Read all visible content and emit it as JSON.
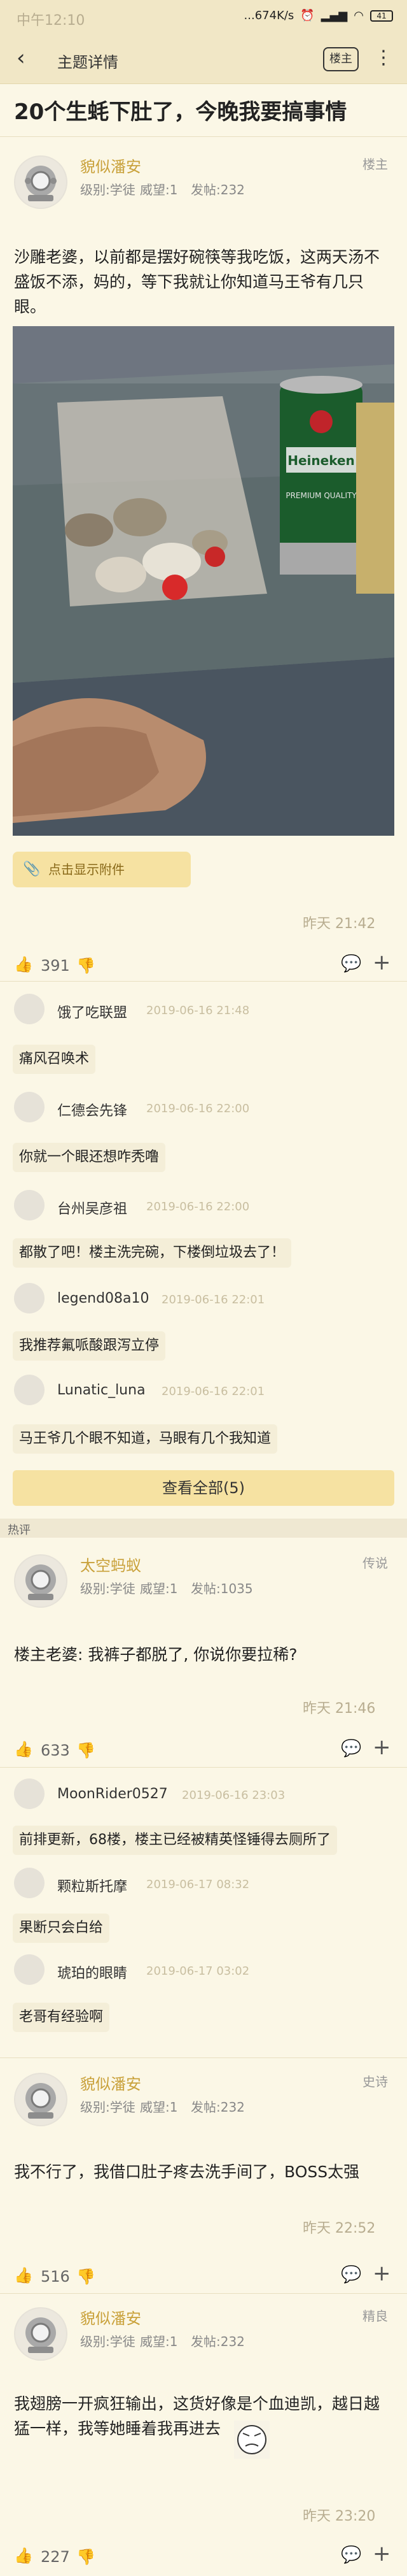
{
  "status": {
    "time": "中午12:10",
    "network": "...674K/s",
    "battery": "41"
  },
  "nav": {
    "title": "主题详情",
    "owner_button": "楼主"
  },
  "topic_title": "20个生蚝下肚了，今晚我要搞事情",
  "main_post": {
    "user": "貌似潘安",
    "level": "级别:学徒",
    "prestige": "威望:1",
    "posts": "发帖:232",
    "tag": "楼主",
    "text": "沙雕老婆，以前都是摆好碗筷等我吃饭，这两天汤不盛饭不添，妈的，等下我就让你知道马王爷有几只眼。",
    "photo_labels": [
      "Heineken",
      "Heineken",
      "PREMIUM QUALITY"
    ],
    "attach_label": "点击显示附件",
    "time": "昨天 21:42",
    "likes": "391"
  },
  "comments_1": [
    {
      "user": "饿了吃联盟",
      "time": "2019-06-16 21:48",
      "text": "痛风召唤术"
    },
    {
      "user": "仁德会先锋",
      "time": "2019-06-16 22:00",
      "text": "你就一个眼还想咋秃噜"
    },
    {
      "user": "台州吴彦祖",
      "time": "2019-06-16 22:00",
      "text": "都散了吧！楼主洗完碗，下楼倒垃圾去了！"
    },
    {
      "user": "legend08a10",
      "time": "2019-06-16 22:01",
      "text": "我推荐氟哌酸跟泻立停"
    },
    {
      "user": "Lunatic_luna",
      "time": "2019-06-16 22:01",
      "text": "马王爷几个眼不知道，马眼有几个我知道"
    }
  ],
  "view_all_label": "查看全部(5)",
  "hot_label": "热评",
  "reply1": {
    "user": "太空蚂蚁",
    "level": "级别:学徒",
    "prestige": "威望:1",
    "posts": "发帖:1035",
    "tag": "传说",
    "text": "楼主老婆: 我裤子都脱了, 你说你要拉稀?",
    "time": "昨天 21:46",
    "likes": "633"
  },
  "comments_2": [
    {
      "user": "MoonRider0527",
      "time": "2019-06-16 23:03",
      "text": "前排更新，68楼，楼主已经被精英怪锤得去厕所了"
    },
    {
      "user": "颗粒斯托摩",
      "time": "2019-06-17 08:32",
      "text": "果断只会白给"
    },
    {
      "user": "琥珀的眼睛",
      "time": "2019-06-17 03:02",
      "text": "老哥有经验啊"
    }
  ],
  "reply2": {
    "user": "貌似潘安",
    "level": "级别:学徒",
    "prestige": "威望:1",
    "posts": "发帖:232",
    "tag": "史诗",
    "text": "我不行了，我借口肚子疼去洗手间了，BOSS太强",
    "time": "昨天 22:52",
    "likes": "516"
  },
  "reply3": {
    "user": "貌似潘安",
    "level": "级别:学徒",
    "prestige": "威望:1",
    "posts": "发帖:232",
    "tag": "精良",
    "text": "我翅膀一开疯狂输出，这货好像是个血迪凯，越日越猛一样，我等她睡着我再进去",
    "time": "昨天 23:20",
    "likes": "227"
  }
}
